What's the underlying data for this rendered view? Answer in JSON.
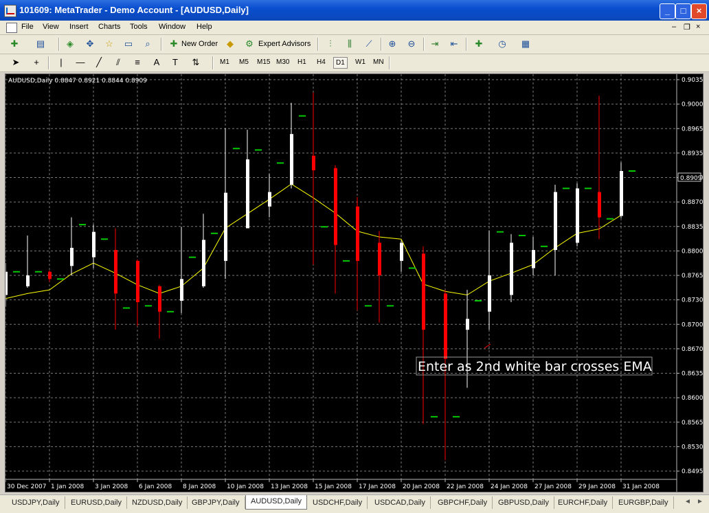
{
  "window": {
    "title": "101609: MetaTrader - Demo Account - [AUDUSD,Daily]"
  },
  "menu": [
    "File",
    "View",
    "Insert",
    "Charts",
    "Tools",
    "Window",
    "Help"
  ],
  "toolbar": {
    "new_order": "New Order",
    "expert_advisors": "Expert Advisors"
  },
  "timeframes": [
    "M1",
    "M5",
    "M15",
    "M30",
    "H1",
    "H4",
    "D1",
    "W1",
    "MN"
  ],
  "active_timeframe": "D1",
  "chart": {
    "header": "AUDUSD,Daily  0.8847 0.8921 0.8844 0.8909",
    "annotation": "Enter as 2nd white bar crosses EMA",
    "current_price": "0.8909"
  },
  "tabs": [
    "USDJPY,Daily",
    "EURUSD,Daily",
    "NZDUSD,Daily",
    "GBPJPY,Daily",
    "AUDUSD,Daily",
    "USDCHF,Daily",
    "USDCAD,Daily",
    "GBPCHF,Daily",
    "GBPUSD,Daily",
    "EURCHF,Daily",
    "EURGBP,Daily"
  ],
  "active_tab": "AUDUSD,Daily",
  "colors": {
    "bull": "#ffffff",
    "bear": "#ff0000",
    "ema": "#ffff00",
    "psar": "#00cc00",
    "grid": "#7a7a7a",
    "background": "#000000"
  },
  "chart_data": {
    "type": "candlestick",
    "title": "AUDUSD,Daily",
    "ylim": [
      0.8495,
      0.9035
    ],
    "y_ticks": [
      "0.9035",
      "0.9000",
      "0.8965",
      "0.8935",
      "0.8900",
      "0.8870",
      "0.8835",
      "0.8800",
      "0.8765",
      "0.8730",
      "0.8700",
      "0.8670",
      "0.8635",
      "0.8600",
      "0.8565",
      "0.8530",
      "0.8495"
    ],
    "x_labels": [
      "30 Dec 2007",
      "1 Jan 2008",
      "3 Jan 2008",
      "6 Jan 2008",
      "8 Jan 2008",
      "10 Jan 2008",
      "13 Jan 2008",
      "15 Jan 2008",
      "17 Jan 2008",
      "20 Jan 2008",
      "22 Jan 2008",
      "24 Jan 2008",
      "27 Jan 2008",
      "29 Jan 2008",
      "31 Jan 2008"
    ],
    "candles": [
      {
        "o": 0.8738,
        "h": 0.8782,
        "l": 0.8722,
        "c": 0.877
      },
      {
        "o": 0.875,
        "h": 0.882,
        "l": 0.8748,
        "c": 0.8765
      },
      {
        "o": 0.877,
        "h": 0.8772,
        "l": 0.8756,
        "c": 0.876
      },
      {
        "o": 0.8778,
        "h": 0.8845,
        "l": 0.8765,
        "c": 0.8803
      },
      {
        "o": 0.879,
        "h": 0.8835,
        "l": 0.8775,
        "c": 0.8825
      },
      {
        "o": 0.88,
        "h": 0.883,
        "l": 0.869,
        "c": 0.874
      },
      {
        "o": 0.8785,
        "h": 0.8787,
        "l": 0.8695,
        "c": 0.8728
      },
      {
        "o": 0.875,
        "h": 0.8752,
        "l": 0.8678,
        "c": 0.8715
      },
      {
        "o": 0.873,
        "h": 0.8832,
        "l": 0.8713,
        "c": 0.876
      },
      {
        "o": 0.875,
        "h": 0.885,
        "l": 0.8748,
        "c": 0.8814
      },
      {
        "o": 0.8785,
        "h": 0.8968,
        "l": 0.876,
        "c": 0.8879
      },
      {
        "o": 0.883,
        "h": 0.8966,
        "l": 0.883,
        "c": 0.8925
      },
      {
        "o": 0.886,
        "h": 0.8905,
        "l": 0.8845,
        "c": 0.888
      },
      {
        "o": 0.889,
        "h": 0.9003,
        "l": 0.8885,
        "c": 0.896
      },
      {
        "o": 0.893,
        "h": 0.9017,
        "l": 0.878,
        "c": 0.891
      },
      {
        "o": 0.8913,
        "h": 0.8917,
        "l": 0.874,
        "c": 0.8807
      },
      {
        "o": 0.886,
        "h": 0.8873,
        "l": 0.8717,
        "c": 0.8785
      },
      {
        "o": 0.881,
        "h": 0.8826,
        "l": 0.87,
        "c": 0.8765
      },
      {
        "o": 0.8785,
        "h": 0.8813,
        "l": 0.877,
        "c": 0.881
      },
      {
        "o": 0.8795,
        "h": 0.8805,
        "l": 0.856,
        "c": 0.869
      },
      {
        "o": 0.874,
        "h": 0.8745,
        "l": 0.851,
        "c": 0.865
      },
      {
        "o": 0.869,
        "h": 0.8745,
        "l": 0.861,
        "c": 0.8705
      },
      {
        "o": 0.8715,
        "h": 0.8827,
        "l": 0.869,
        "c": 0.8765
      },
      {
        "o": 0.8738,
        "h": 0.8822,
        "l": 0.8728,
        "c": 0.881
      },
      {
        "o": 0.8775,
        "h": 0.8818,
        "l": 0.8765,
        "c": 0.88
      },
      {
        "o": 0.88,
        "h": 0.889,
        "l": 0.8765,
        "c": 0.888
      },
      {
        "o": 0.881,
        "h": 0.8892,
        "l": 0.8805,
        "c": 0.8885
      },
      {
        "o": 0.888,
        "h": 0.9013,
        "l": 0.8815,
        "c": 0.8845
      },
      {
        "o": 0.8847,
        "h": 0.8921,
        "l": 0.8844,
        "c": 0.8909
      }
    ],
    "ema": [
      0.8733,
      0.874,
      0.8745,
      0.8767,
      0.8782,
      0.8768,
      0.8752,
      0.874,
      0.875,
      0.8775,
      0.883,
      0.885,
      0.887,
      0.8891,
      0.8872,
      0.8851,
      0.8826,
      0.8818,
      0.8815,
      0.8753,
      0.8743,
      0.8738,
      0.8757,
      0.8768,
      0.878,
      0.8803,
      0.8823,
      0.8829,
      0.8848
    ],
    "psar": [
      0.877,
      0.877,
      0.876,
      0.8835,
      0.8815,
      0.872,
      0.8723,
      0.8715,
      0.879,
      0.8823,
      0.894,
      0.8938,
      0.892,
      0.8985,
      0.8832,
      0.8785,
      0.8723,
      0.8723,
      0.8775,
      0.857,
      0.857,
      0.873,
      0.8825,
      0.882,
      0.8805,
      0.8885,
      0.8885,
      0.8843,
      0.8909
    ]
  }
}
